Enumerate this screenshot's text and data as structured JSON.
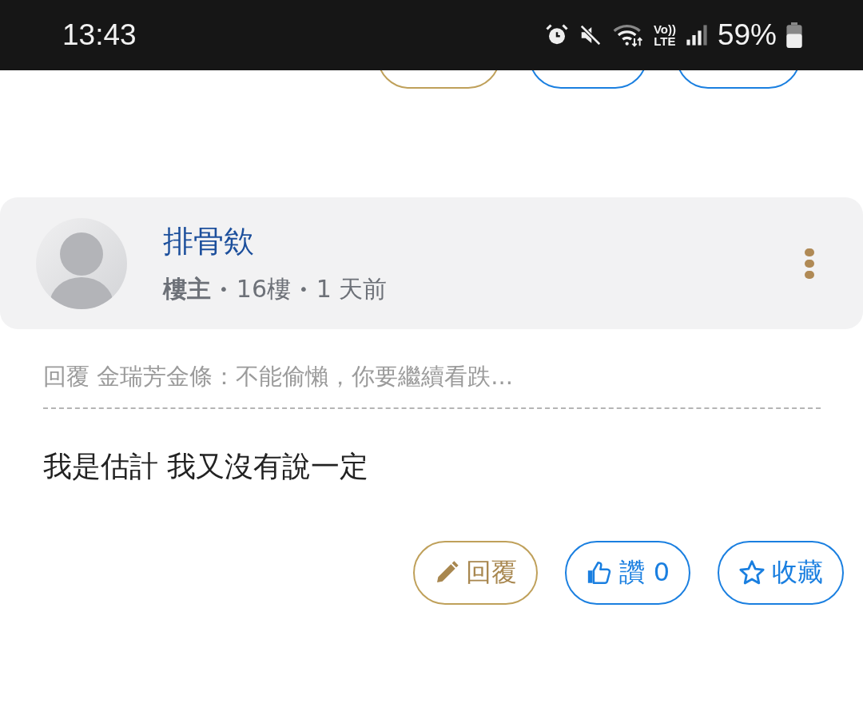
{
  "status_bar": {
    "time": "13:43",
    "volte_top": "Vo))",
    "volte_bottom": "LTE",
    "battery": "59%"
  },
  "top_buttons": [
    {
      "kind": "reply"
    },
    {
      "kind": "like"
    },
    {
      "kind": "favorite"
    }
  ],
  "post": {
    "author": "排骨欸",
    "role": "樓主",
    "separator": "•",
    "floor": "16樓",
    "time": "1 天前",
    "reply_to": "回覆 金瑞芳金條：不能偷懶，你要繼續看跌...",
    "body": "我是估計 我又沒有說一定",
    "actions": [
      {
        "kind": "reply",
        "label": "回覆"
      },
      {
        "kind": "like",
        "label": "讚 0"
      },
      {
        "kind": "favorite",
        "label": "收藏"
      }
    ]
  }
}
